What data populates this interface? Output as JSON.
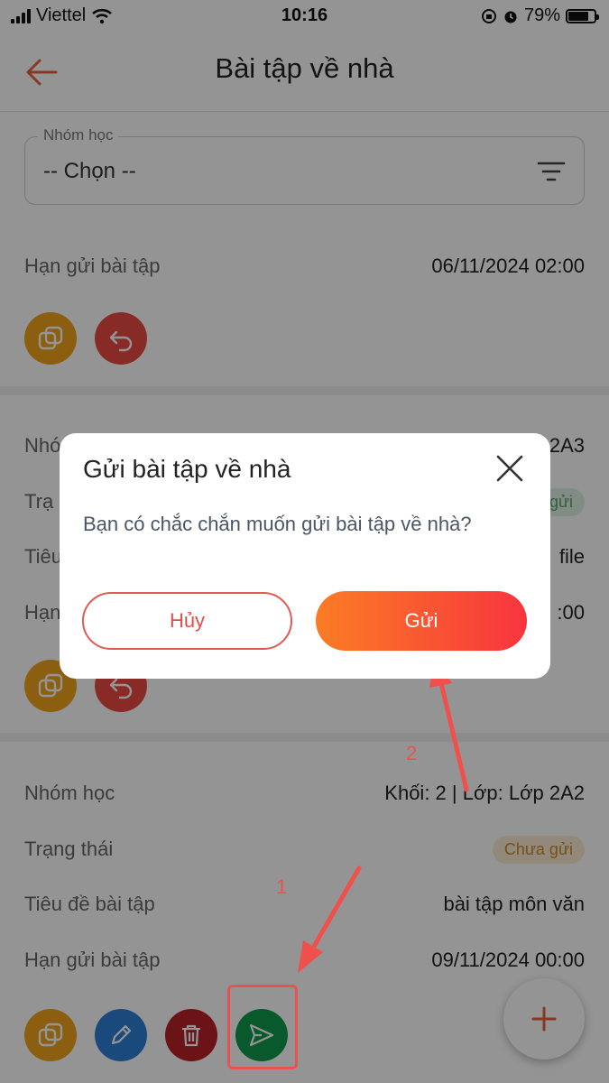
{
  "status_bar": {
    "carrier": "Viettel",
    "time": "10:16",
    "battery": "79%",
    "battery_level": 0.79
  },
  "header": {
    "title": "Bài tập về nhà",
    "back_icon": "arrow-left-icon"
  },
  "filter": {
    "label": "Nhóm học",
    "value": "-- Chọn --",
    "icon": "filter-lines-icon"
  },
  "cards": [
    {
      "rows": [
        {
          "label": "Hạn gửi bài tập",
          "value": "06/11/2024 02:00"
        }
      ]
    },
    {
      "rows": [
        {
          "label": "Nhó",
          "value": "2A3"
        },
        {
          "label": "Trạ",
          "value": "gửi"
        },
        {
          "label": "Tiêu",
          "value": "file"
        },
        {
          "label": "Hạn",
          "value": ":00"
        }
      ]
    },
    {
      "rows": [
        {
          "label": "Nhóm học",
          "value": "Khối: 2 | Lớp: Lớp 2A2"
        },
        {
          "label": "Trạng thái",
          "value": "Chưa gửi"
        },
        {
          "label": "Tiêu đề bài tập",
          "value": "bài tập môn văn"
        },
        {
          "label": "Hạn gửi bài tập",
          "value": "09/11/2024 00:00"
        }
      ]
    }
  ],
  "dialog": {
    "title": "Gửi bài tập về nhà",
    "message": "Bạn có chắc chắn muốn gửi bài tập về nhà?",
    "cancel_label": "Hủy",
    "confirm_label": "Gửi"
  },
  "annotations": {
    "step1": "1",
    "step2": "2"
  },
  "colors": {
    "accent": "#f06a3a",
    "copy": "#f0a31c",
    "undo": "#ea4a44",
    "edit": "#2e7fd6",
    "delete": "#b92226",
    "send": "#0e9a4c",
    "annotation": "#e8534f"
  }
}
